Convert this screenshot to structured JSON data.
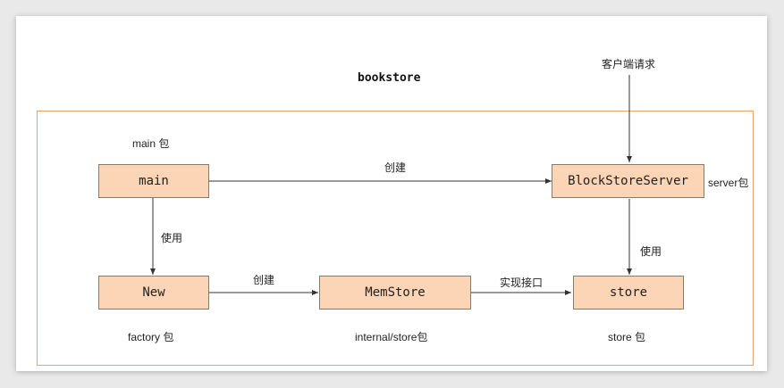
{
  "title": "bookstore",
  "nodes": {
    "main": "main",
    "server": "BlockStoreServer",
    "new": "New",
    "memstore": "MemStore",
    "store": "store"
  },
  "labels": {
    "client_request": "客户端请求",
    "main_pkg": "main 包",
    "server_pkg": "server包",
    "factory_pkg": "factory 包",
    "internal_pkg": "internal/store包",
    "store_pkg": "store 包"
  },
  "edges": {
    "main_to_server": "创建",
    "main_to_new": "使用",
    "new_to_memstore": "创建",
    "memstore_to_store": "实现接口",
    "server_to_store": "使用"
  },
  "colors": {
    "node_fill": "#fbd5b5",
    "frame_border": "#e8a366",
    "arrow": "#333333"
  }
}
